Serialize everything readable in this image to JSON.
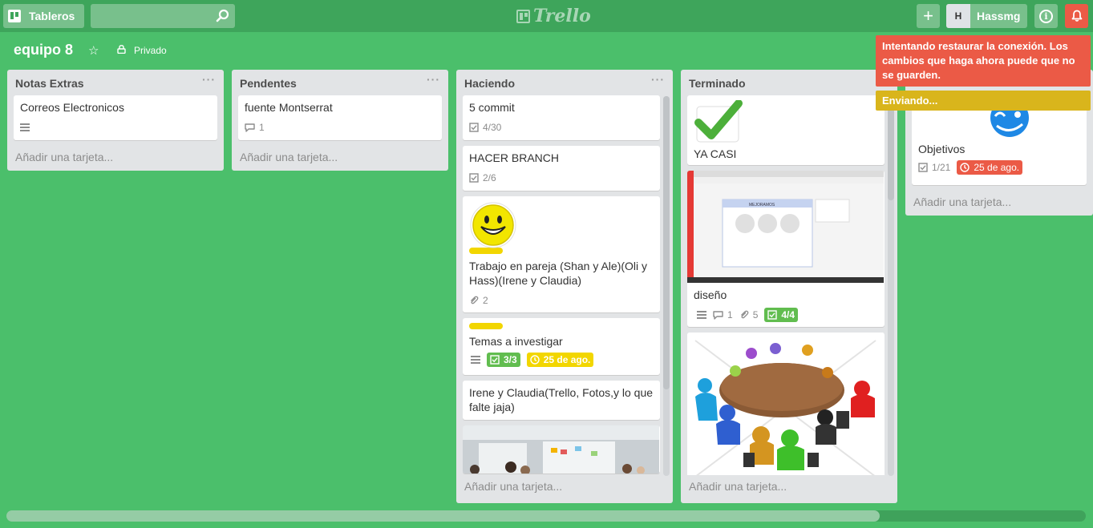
{
  "header": {
    "boards_label": "Tableros",
    "logo_text": "Trello",
    "user_initial": "H",
    "user_name": "Hassmg",
    "add_label": "+",
    "info_label": "i"
  },
  "board": {
    "title": "equipo 8",
    "privacy": "Privado"
  },
  "lists": [
    {
      "name": "Notas Extras",
      "menu": "···",
      "cards": [
        {
          "title": "Correos Electronicos"
        }
      ],
      "add_card": "Añadir una tarjeta..."
    },
    {
      "name": "Pendentes",
      "menu": "···",
      "cards": [
        {
          "title": "fuente Montserrat",
          "comments": "1"
        }
      ],
      "add_card": "Añadir una tarjeta..."
    },
    {
      "name": "Haciendo",
      "menu": "···",
      "cards": [
        {
          "title": "5 commit",
          "checklist": "4/30"
        },
        {
          "title": "HACER BRANCH",
          "checklist": "2/6"
        },
        {
          "title": "Trabajo en pareja (Shan y Ale)(Oli y Hass)(Irene y Claudia)",
          "attachments": "2",
          "cover": "smiley"
        },
        {
          "title": "Temas a investigar",
          "checklist": "3/3",
          "due": "25 de ago."
        },
        {
          "title": "Irene y Claudia(Trello, Fotos,y lo que falte jaja)"
        }
      ],
      "add_card": "Añadir una tarjeta..."
    },
    {
      "name": "Terminado",
      "menu": "···",
      "cards": [
        {
          "title": "YA CASI",
          "cover": "checkmark"
        },
        {
          "title": "diseño",
          "comments": "1",
          "attachments": "5",
          "checklist": "4/4",
          "cover_text": "MEJORAMOS"
        },
        {
          "title": "",
          "cover": "meeting"
        }
      ],
      "add_card": "Añadir una tarjeta..."
    },
    {
      "name": "",
      "cards": [
        {
          "title": "Objetivos",
          "checklist": "1/21",
          "due": "25 de ago."
        }
      ],
      "add_card": "Añadir una tarjeta..."
    }
  ],
  "alerts": {
    "connection": "Intentando restaurar la conexión. Los cambios que haga ahora puede que no se guarden.",
    "sending": "Enviando..."
  },
  "colors": {
    "board_bg": "#4bbf6b",
    "header_bg": "#3ea55b",
    "label_yellow": "#f2d600",
    "badge_green": "#61bd4f",
    "badge_red": "#eb5a46",
    "alert_red": "#eb5a46",
    "alert_yellow": "#d9b51c"
  }
}
